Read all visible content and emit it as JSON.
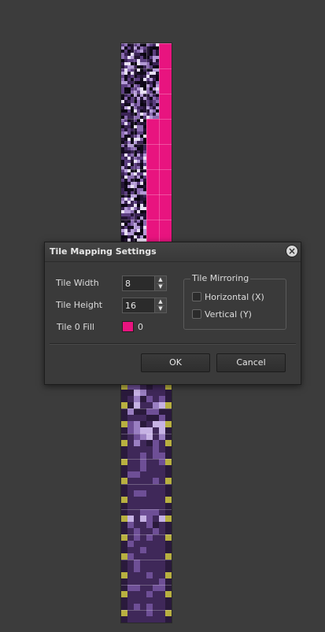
{
  "dialog": {
    "title": "Tile Mapping Settings",
    "close_icon": "close-icon",
    "fields": {
      "tile_width_label": "Tile Width",
      "tile_width_value": "8",
      "tile_height_label": "Tile Height",
      "tile_height_value": "16",
      "tile0_fill_label": "Tile 0 Fill",
      "tile0_fill_value": "0",
      "tile0_fill_color": "#e8147f"
    },
    "mirroring": {
      "title": "Tile Mirroring",
      "horizontal_label": "Horizontal (X)",
      "horizontal_checked": false,
      "vertical_label": "Vertical (Y)",
      "vertical_checked": false
    },
    "buttons": {
      "ok_label": "OK",
      "cancel_label": "Cancel"
    }
  },
  "colors": {
    "background": "#3c3c3c",
    "fill_pink": "#e8147f",
    "tile_purple": "#3f2859",
    "tile_lavender": "#8a6bb0"
  }
}
